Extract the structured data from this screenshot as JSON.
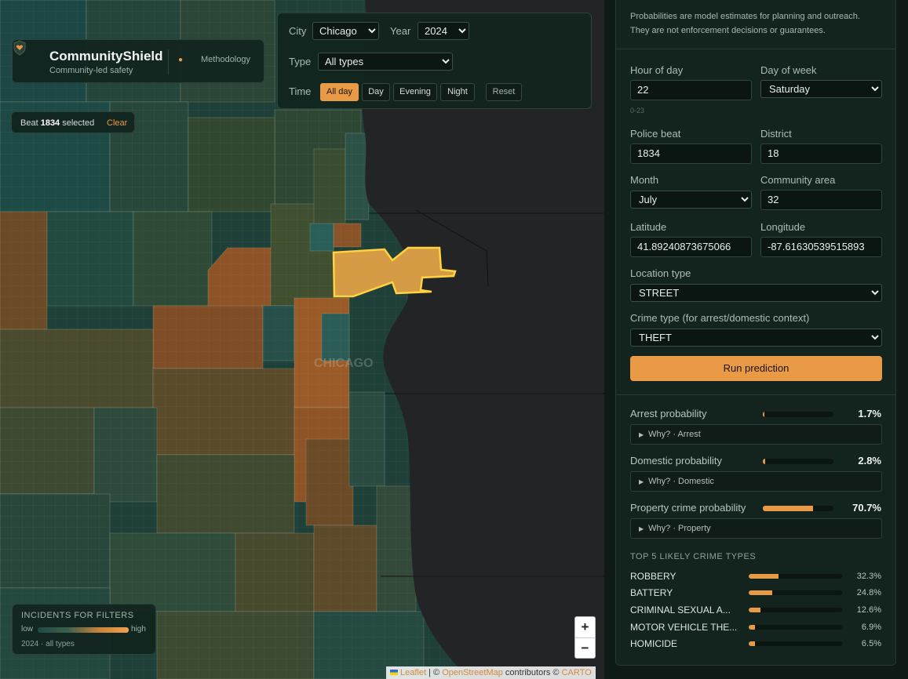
{
  "brand": {
    "name": "CommunityShield",
    "tagline": "Community-led safety",
    "methodology": "Methodology"
  },
  "selection": {
    "prefix": "Beat",
    "beat": "1834",
    "suffix": "selected",
    "clear": "Clear"
  },
  "filters": {
    "city_label": "City",
    "city": "Chicago",
    "year_label": "Year",
    "year": "2024",
    "type_label": "Type",
    "type": "All types",
    "time_label": "Time",
    "time_options": [
      "All day",
      "Day",
      "Evening",
      "Night"
    ],
    "time_selected": "All day",
    "reset": "Reset"
  },
  "map": {
    "city_label": "CHICAGO",
    "zoom_in": "+",
    "zoom_out": "−",
    "attribution": {
      "leaflet": "Leaflet",
      "sep": "| ©",
      "osm": "OpenStreetMap",
      "contrib": "contributors ©",
      "carto": "CARTO"
    }
  },
  "legend": {
    "title": "INCIDENTS FOR FILTERS",
    "low": "low",
    "high": "high",
    "subtitle": "2024 · all types"
  },
  "panel": {
    "disclaimer": "Probabilities are model estimates for planning and outreach. They are not enforcement decisions or guarantees.",
    "hour_label": "Hour of day",
    "hour": "22",
    "hour_hint": "0-23",
    "dow_label": "Day of week",
    "dow": "Saturday",
    "beat_label": "Police beat",
    "beat": "1834",
    "district_label": "District",
    "district": "18",
    "month_label": "Month",
    "month": "July",
    "community_label": "Community area",
    "community": "32",
    "lat_label": "Latitude",
    "lat": "41.89240873675066",
    "lon_label": "Longitude",
    "lon": "-87.61630539515893",
    "location_label": "Location type",
    "location": "STREET",
    "crime_label": "Crime type (for arrest/domestic context)",
    "crime": "THEFT",
    "run": "Run prediction"
  },
  "results": [
    {
      "label": "Arrest probability",
      "value": "1.7%",
      "fraction": 0.017,
      "why": "Why? · Arrest"
    },
    {
      "label": "Domestic probability",
      "value": "2.8%",
      "fraction": 0.028,
      "why": "Why? · Domestic"
    },
    {
      "label": "Property crime probability",
      "value": "70.7%",
      "fraction": 0.707,
      "why": "Why? · Property"
    }
  ],
  "top_title": "TOP 5 LIKELY CRIME TYPES",
  "top_types": [
    {
      "name": "ROBBERY",
      "value": "32.3%",
      "fraction": 0.323
    },
    {
      "name": "BATTERY",
      "value": "24.8%",
      "fraction": 0.248
    },
    {
      "name": "CRIMINAL SEXUAL A...",
      "value": "12.6%",
      "fraction": 0.126
    },
    {
      "name": "MOTOR VEHICLE THE...",
      "value": "6.9%",
      "fraction": 0.069
    },
    {
      "name": "HOMICIDE",
      "value": "6.5%",
      "fraction": 0.065
    }
  ],
  "colors": {
    "accent": "#e89a47",
    "panel": "#13231e",
    "low": "#1d4c47",
    "high": "#f0a050"
  }
}
